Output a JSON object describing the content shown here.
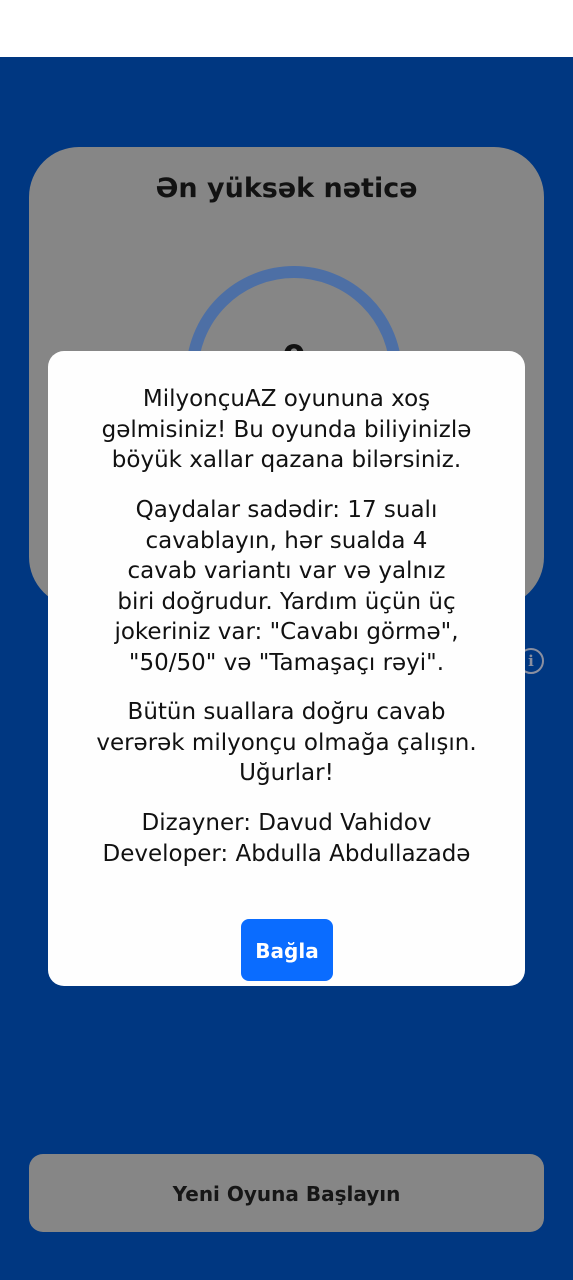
{
  "score_card": {
    "title": "Ən yüksək nəticə",
    "score": "0"
  },
  "icons": {
    "info": "info-icon"
  },
  "new_game_button": {
    "label": "Yeni Oyuna Başlayın"
  },
  "dialog": {
    "paragraphs": [
      {
        "lines": [
          "MilyonçuAZ oyununa xoş",
          "gəlmisiniz! Bu oyunda biliyinizlə",
          "böyük xallar qazana bilərsiniz."
        ]
      },
      {
        "lines": [
          "Qaydalar sadədir: 17 sualı",
          "cavablayın, hər sualda 4",
          "cavab variantı var və yalnız",
          "biri doğrudur. Yardım üçün üç",
          "jokeriniz var: \"Cavabı görmə\",",
          "\"50/50\" və \"Tamaşaçı rəyi\"."
        ]
      },
      {
        "lines": [
          "Bütün suallara doğru cavab",
          "verərək milyonçu olmağa çalışın.",
          "Uğurlar!"
        ]
      },
      {
        "lines": [
          "Dizayner: Davud Vahidov",
          "Developer: Abdulla Abdullazadə"
        ]
      }
    ],
    "close_label": "Bağla"
  },
  "colors": {
    "app_background": "#003781",
    "card_background": "#868686",
    "ring": "#4d6fa5",
    "dialog_background": "#fefefe",
    "primary_button": "#0a6cff"
  }
}
